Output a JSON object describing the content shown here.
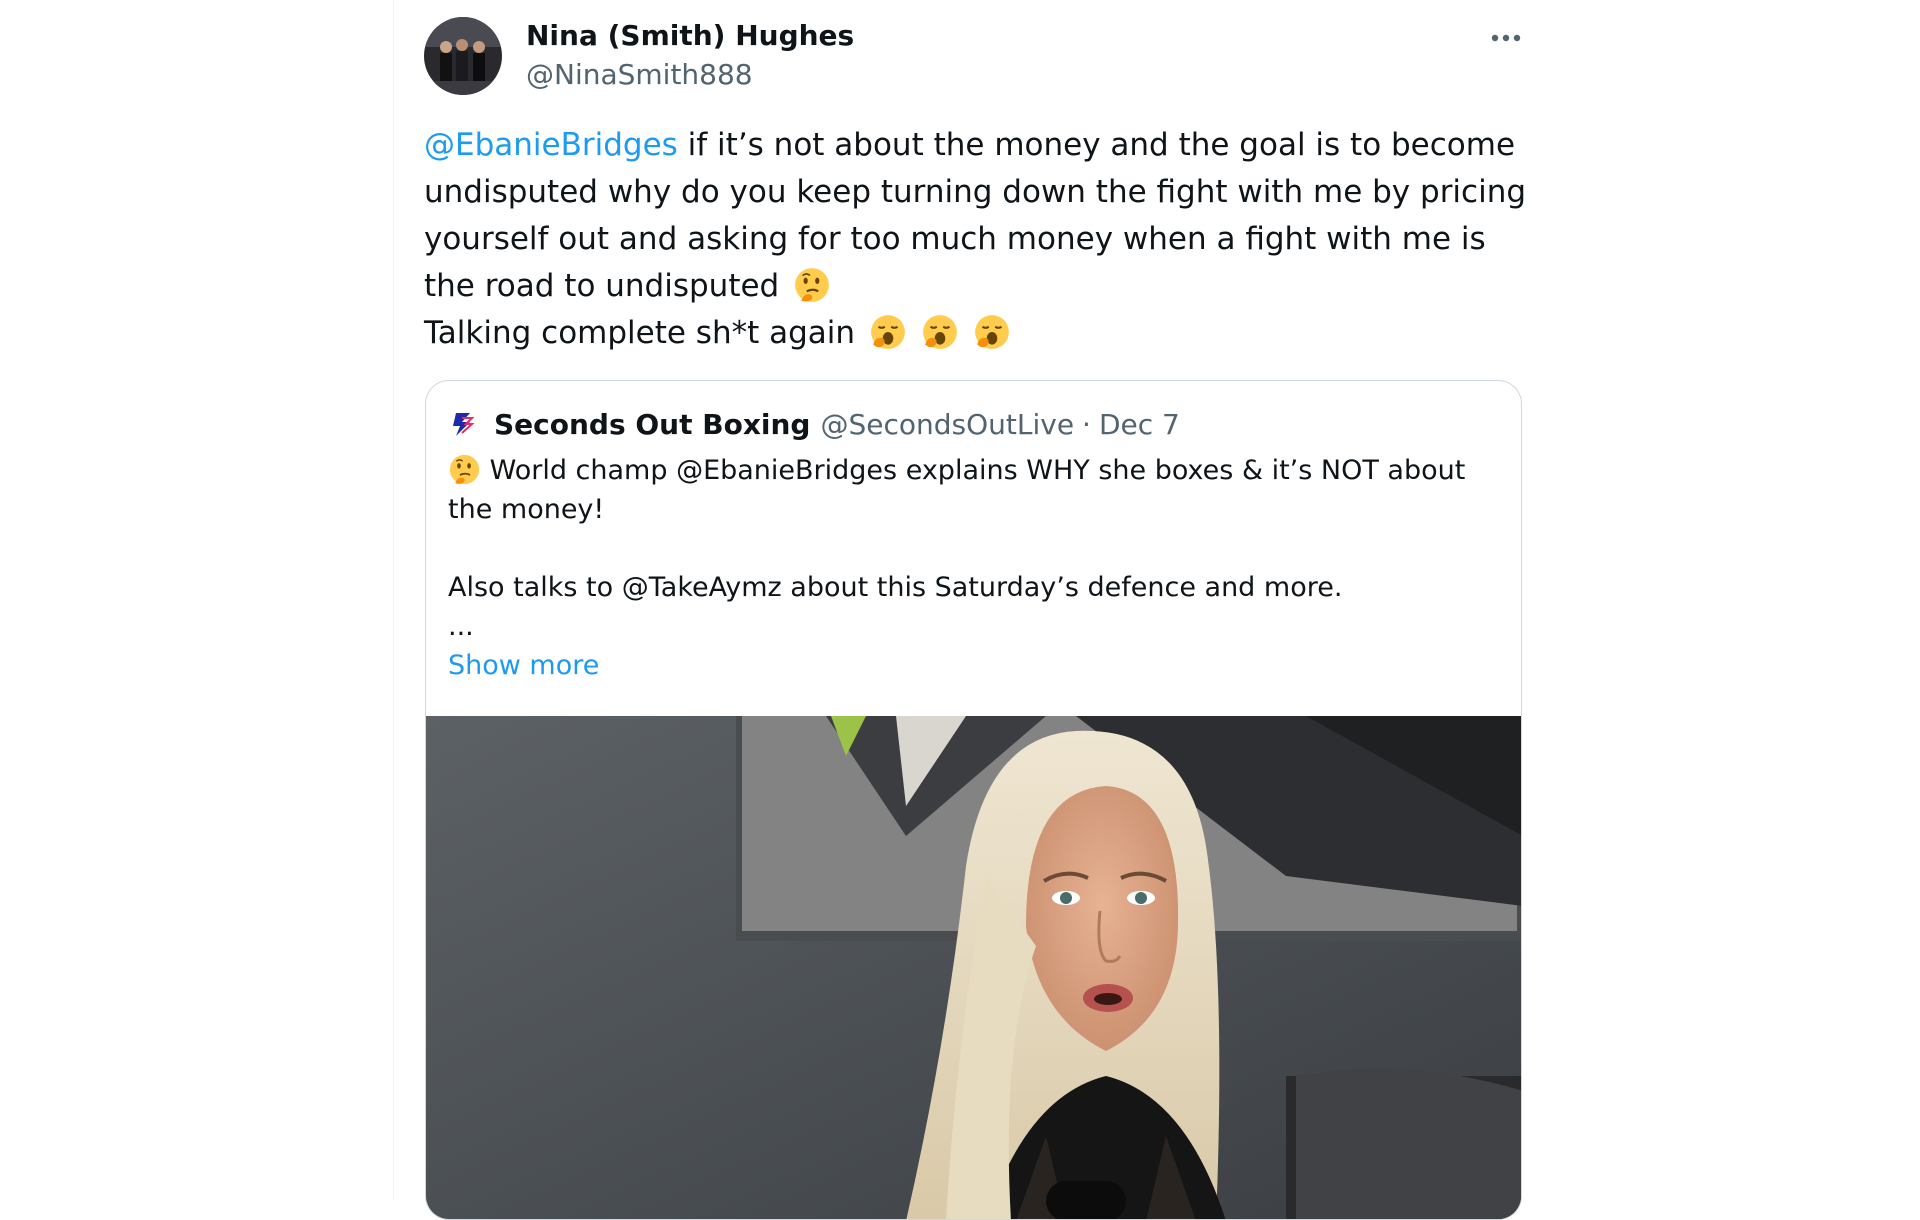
{
  "tweet": {
    "display_name": "Nina (Smith) Hughes",
    "handle": "@NinaSmith888",
    "more_icon": "more-horizontal-icon",
    "mention": "@EbanieBridges",
    "text_part1": " if it’s not about the money and the goal is to become undisputed why do you keep turning down the fight with me by pricing yourself out and asking for too much money when a fight with me is the road to undisputed",
    "text_part2": "Talking complete sh*t again",
    "emojis": [
      "thinking-face-emoji",
      "yawning-face-emoji"
    ]
  },
  "quote": {
    "account_name": "Seconds Out Boxing",
    "handle": "@SecondsOutLive",
    "separator": "·",
    "date": "Dec 7",
    "body_line1": " World champ @EbanieBridges explains WHY she boxes & it’s NOT about the money!",
    "body_line2": "Also talks to @TakeAymz about this Saturday’s defence and more.",
    "ellipsis": "...",
    "show_more": "Show more"
  },
  "colors": {
    "link": "#1d9bf0",
    "secondary_text": "#536471",
    "border": "#cfd9de"
  }
}
